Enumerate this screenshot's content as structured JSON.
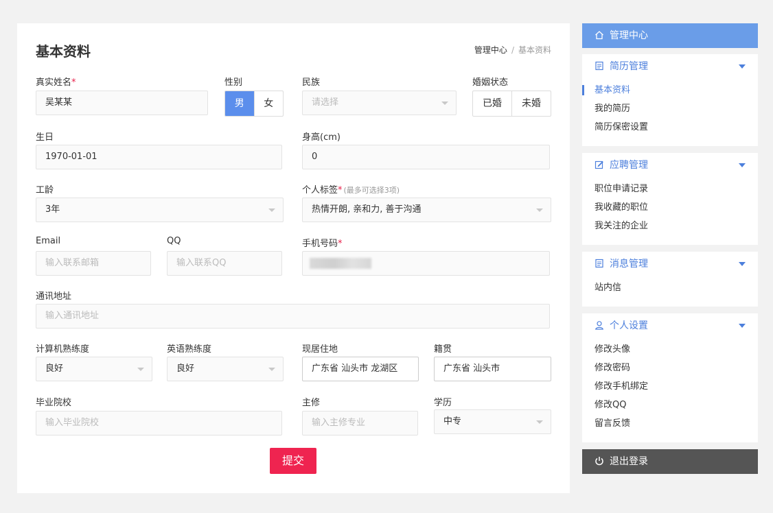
{
  "page": {
    "title": "基本资料"
  },
  "breadcrumb": {
    "home": "管理中心",
    "separator": "/",
    "current": "基本资料"
  },
  "form": {
    "real_name": {
      "label": "真实姓名",
      "required": "*",
      "value": "吴某某"
    },
    "gender": {
      "label": "性别",
      "options": [
        "男",
        "女"
      ],
      "selected": "男"
    },
    "ethnicity": {
      "label": "民族",
      "placeholder": "请选择"
    },
    "marital": {
      "label": "婚姻状态",
      "options": [
        "已婚",
        "未婚"
      ]
    },
    "birthday": {
      "label": "生日",
      "value": "1970-01-01"
    },
    "height": {
      "label": "身高(cm)",
      "value": "0"
    },
    "work_years": {
      "label": "工龄",
      "value": "3年"
    },
    "tags": {
      "label": "个人标签",
      "required": "*",
      "hint": "(最多可选择3项)",
      "value": "热情开朗, 亲和力, 善于沟通"
    },
    "email": {
      "label": "Email",
      "placeholder": "输入联系邮箱"
    },
    "qq": {
      "label": "QQ",
      "placeholder": "输入联系QQ"
    },
    "phone": {
      "label": "手机号码",
      "required": "*"
    },
    "address": {
      "label": "通讯地址",
      "placeholder": "输入通讯地址"
    },
    "computer_skill": {
      "label": "计算机熟练度",
      "value": "良好"
    },
    "english_skill": {
      "label": "英语熟练度",
      "value": "良好"
    },
    "residence": {
      "label": "现居住地",
      "value": "广东省 汕头市 龙湖区"
    },
    "hometown": {
      "label": "籍贯",
      "value": "广东省 汕头市"
    },
    "school": {
      "label": "毕业院校",
      "placeholder": "输入毕业院校"
    },
    "major": {
      "label": "主修",
      "placeholder": "输入主修专业"
    },
    "education": {
      "label": "学历",
      "value": "中专"
    },
    "submit_label": "提交"
  },
  "sidebar": {
    "header": "管理中心",
    "resume": {
      "title": "简历管理",
      "items": [
        "基本资料",
        "我的简历",
        "简历保密设置"
      ]
    },
    "apply": {
      "title": "应聘管理",
      "items": [
        "职位申请记录",
        "我收藏的职位",
        "我关注的企业"
      ]
    },
    "message": {
      "title": "消息管理",
      "items": [
        "站内信"
      ]
    },
    "personal": {
      "title": "个人设置",
      "items": [
        "修改头像",
        "修改密码",
        "修改手机绑定",
        "修改QQ",
        "留言反馈"
      ]
    },
    "logout": "退出登录"
  },
  "colors": {
    "accent": "#5b8eec",
    "submit": "#ef2450",
    "sidebar_header": "#6a9de8",
    "logout_bg": "#555555"
  }
}
